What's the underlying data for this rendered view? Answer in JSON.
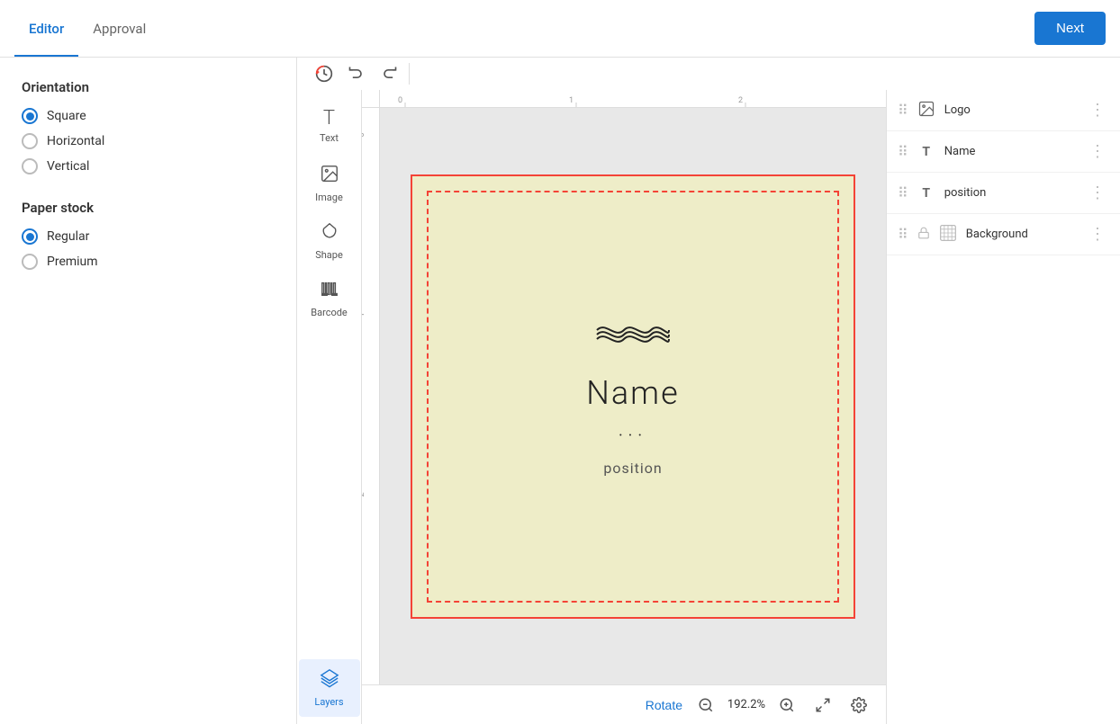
{
  "header": {
    "tabs": [
      {
        "id": "editor",
        "label": "Editor",
        "active": true
      },
      {
        "id": "approval",
        "label": "Approval",
        "active": false
      }
    ],
    "next_button_label": "Next"
  },
  "left_sidebar": {
    "orientation_title": "Orientation",
    "orientation_options": [
      {
        "id": "square",
        "label": "Square",
        "checked": true
      },
      {
        "id": "horizontal",
        "label": "Horizontal",
        "checked": false
      },
      {
        "id": "vertical",
        "label": "Vertical",
        "checked": false
      }
    ],
    "paper_stock_title": "Paper stock",
    "paper_stock_options": [
      {
        "id": "regular",
        "label": "Regular",
        "checked": true
      },
      {
        "id": "premium",
        "label": "Premium",
        "checked": false
      }
    ]
  },
  "toolbar": {
    "top_icons": [
      {
        "id": "history",
        "label": "History"
      },
      {
        "id": "undo",
        "label": "Undo"
      },
      {
        "id": "redo",
        "label": "Redo"
      }
    ],
    "tools": [
      {
        "id": "text",
        "label": "Text",
        "icon": "T"
      },
      {
        "id": "image",
        "label": "Image",
        "icon": "img"
      },
      {
        "id": "shape",
        "label": "Shape",
        "icon": "shape"
      },
      {
        "id": "barcode",
        "label": "Barcode",
        "icon": "barcode"
      },
      {
        "id": "layers",
        "label": "Layers",
        "icon": "layers",
        "active": true
      }
    ]
  },
  "canvas": {
    "card": {
      "name_text": "Name",
      "position_text": "position",
      "dots_text": "···"
    },
    "zoom_value": "192.2%",
    "rotate_label": "Rotate"
  },
  "layers_panel": {
    "items": [
      {
        "id": "logo",
        "name": "Logo",
        "type": "image",
        "locked": false
      },
      {
        "id": "name",
        "name": "Name",
        "type": "text",
        "locked": false
      },
      {
        "id": "position",
        "name": "position",
        "type": "text",
        "locked": false
      },
      {
        "id": "background",
        "name": "Background",
        "type": "background",
        "locked": true
      }
    ]
  },
  "colors": {
    "primary": "#1976d2",
    "accent": "#f44336",
    "card_bg": "#eeedc8"
  }
}
